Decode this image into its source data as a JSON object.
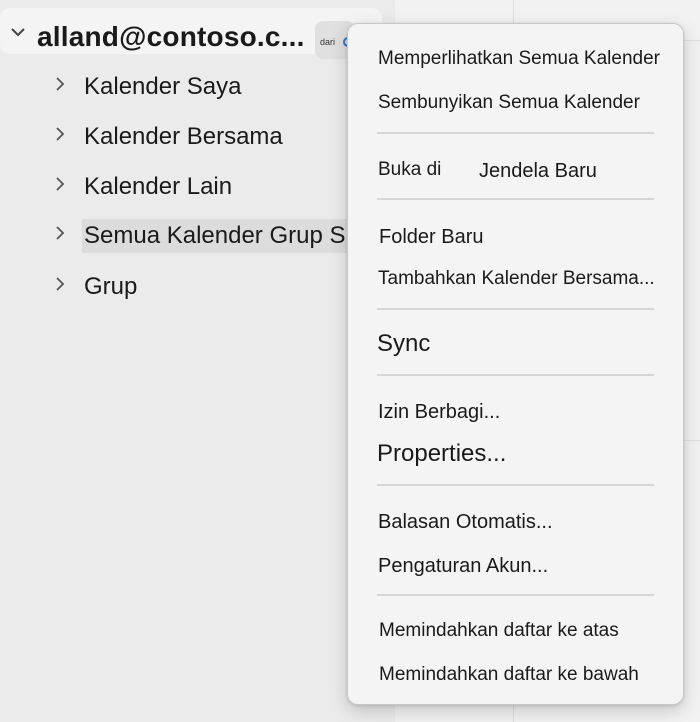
{
  "sidebar": {
    "account": {
      "name": "alland@contoso.c...",
      "badge_text": "dari"
    },
    "items": [
      {
        "label": "Kalender Saya"
      },
      {
        "label": "Kalender Bersama"
      },
      {
        "label": "Kalender Lain"
      },
      {
        "label": "Semua Kalender Grup S"
      },
      {
        "label": "Grup"
      }
    ]
  },
  "context_menu": {
    "show_all": "Memperlihatkan Semua Kalender",
    "hide_all": "Sembunyikan Semua Kalender",
    "open_in": "Buka di",
    "new_window": "Jendela Baru",
    "new_folder": "Folder Baru",
    "add_shared": "Tambahkan Kalender Bersama...",
    "sync": "Sync",
    "share_permissions": "Izin Berbagi...",
    "properties": "Properties...",
    "auto_replies": "Balasan Otomatis...",
    "account_settings": "Pengaturan Akun...",
    "move_up": "Memindahkan daftar ke atas",
    "move_down": "Memindahkan daftar ke bawah"
  },
  "icons": {
    "expand_chevron": "chevron-down-icon",
    "collapsed_chevron": "chevron-right-icon"
  },
  "colors": {
    "sidebar_bg": "#ebebeb",
    "menu_bg": "#f4f4f4",
    "selected_bg": "#dcdcdc",
    "accent": "#2f78d4"
  }
}
